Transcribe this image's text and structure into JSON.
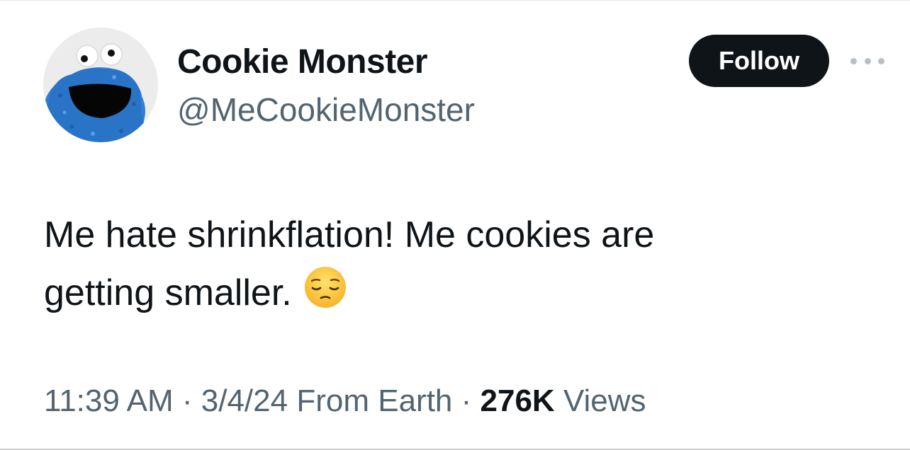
{
  "author": {
    "display_name": "Cookie Monster",
    "handle": "@MeCookieMonster"
  },
  "actions": {
    "follow_label": "Follow",
    "more_icon": "ellipsis-icon"
  },
  "tweet": {
    "text_line1": "Me hate shrinkflation! Me cookies are",
    "text_line2": "getting smaller.",
    "emoji": "pensive-face"
  },
  "meta": {
    "time": "11:39 AM",
    "date": "3/4/24",
    "source": "From Earth",
    "separator": "·",
    "views_count": "276K",
    "views_label": "Views"
  },
  "colors": {
    "text_primary": "#0f1419",
    "text_secondary": "#536471",
    "follow_bg": "#0f1419",
    "avatar_fur": "#2f7fd6"
  }
}
